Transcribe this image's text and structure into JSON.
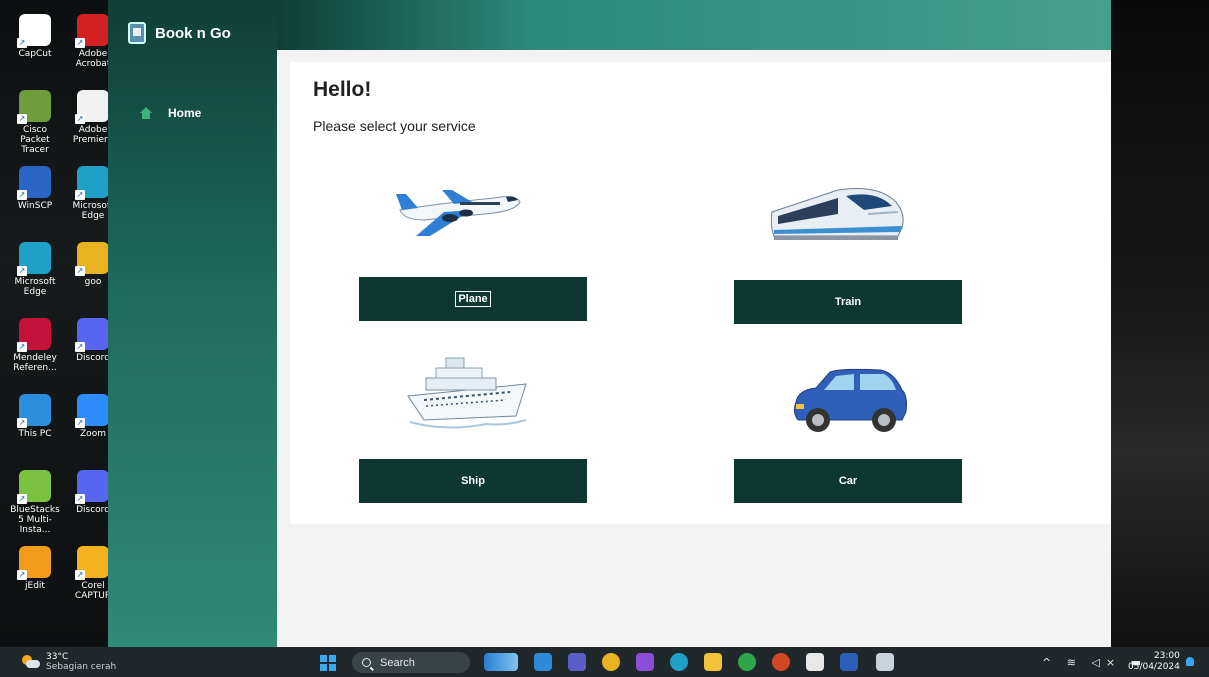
{
  "desktop_icons": [
    {
      "label": "CapCut",
      "icon": "capcut-icon",
      "color": "#ffffff"
    },
    {
      "label": "Adobe Acrobat",
      "icon": "acrobat-icon",
      "color": "#d32020"
    },
    {
      "label": "Cisco Packet Tracer",
      "icon": "packet-tracer-icon",
      "color": "#6e9c3a"
    },
    {
      "label": "Adobe Premiere",
      "icon": "document-icon",
      "color": "#f2f2f2"
    },
    {
      "label": "WinSCP",
      "icon": "winscp-icon",
      "color": "#2a66c8"
    },
    {
      "label": "Microsoft Edge",
      "icon": "edge-icon",
      "color": "#1fa0c8"
    },
    {
      "label": "Microsoft Edge",
      "icon": "edge-icon",
      "color": "#1fa0c8"
    },
    {
      "label": "goo",
      "icon": "chrome-icon",
      "color": "#e8b220"
    },
    {
      "label": "Mendeley Referen...",
      "icon": "mendeley-icon",
      "color": "#c5123a"
    },
    {
      "label": "Discord",
      "icon": "discord-icon",
      "color": "#5865f2"
    },
    {
      "label": "This PC",
      "icon": "monitor-icon",
      "color": "#2b8fe0"
    },
    {
      "label": "Zoom",
      "icon": "zoom-icon",
      "color": "#2d8cff"
    },
    {
      "label": "BlueStacks 5 Multi-Insta...",
      "icon": "bluestacks-icon",
      "color": "#7cc242"
    },
    {
      "label": "Discord",
      "icon": "discord-icon",
      "color": "#5865f2"
    },
    {
      "label": "jEdit",
      "icon": "jedit-icon",
      "color": "#f29a1a"
    },
    {
      "label": "Corel CAPTUR",
      "icon": "corel-capture-icon",
      "color": "#f5b21f"
    }
  ],
  "app": {
    "title": "Book n Go",
    "nav": {
      "home": "Home"
    },
    "greeting": "Hello!",
    "prompt": "Please select your service",
    "services": {
      "plane": "Plane",
      "train": "Train",
      "ship": "Ship",
      "car": "Car"
    },
    "colors": {
      "button": "#0e3732",
      "accent": "#46a08e"
    }
  },
  "taskbar": {
    "weather_temp": "33°C",
    "weather_desc": "Sebagian cerah",
    "search": "Search",
    "time": "23:00",
    "date": "05/04/2024"
  }
}
